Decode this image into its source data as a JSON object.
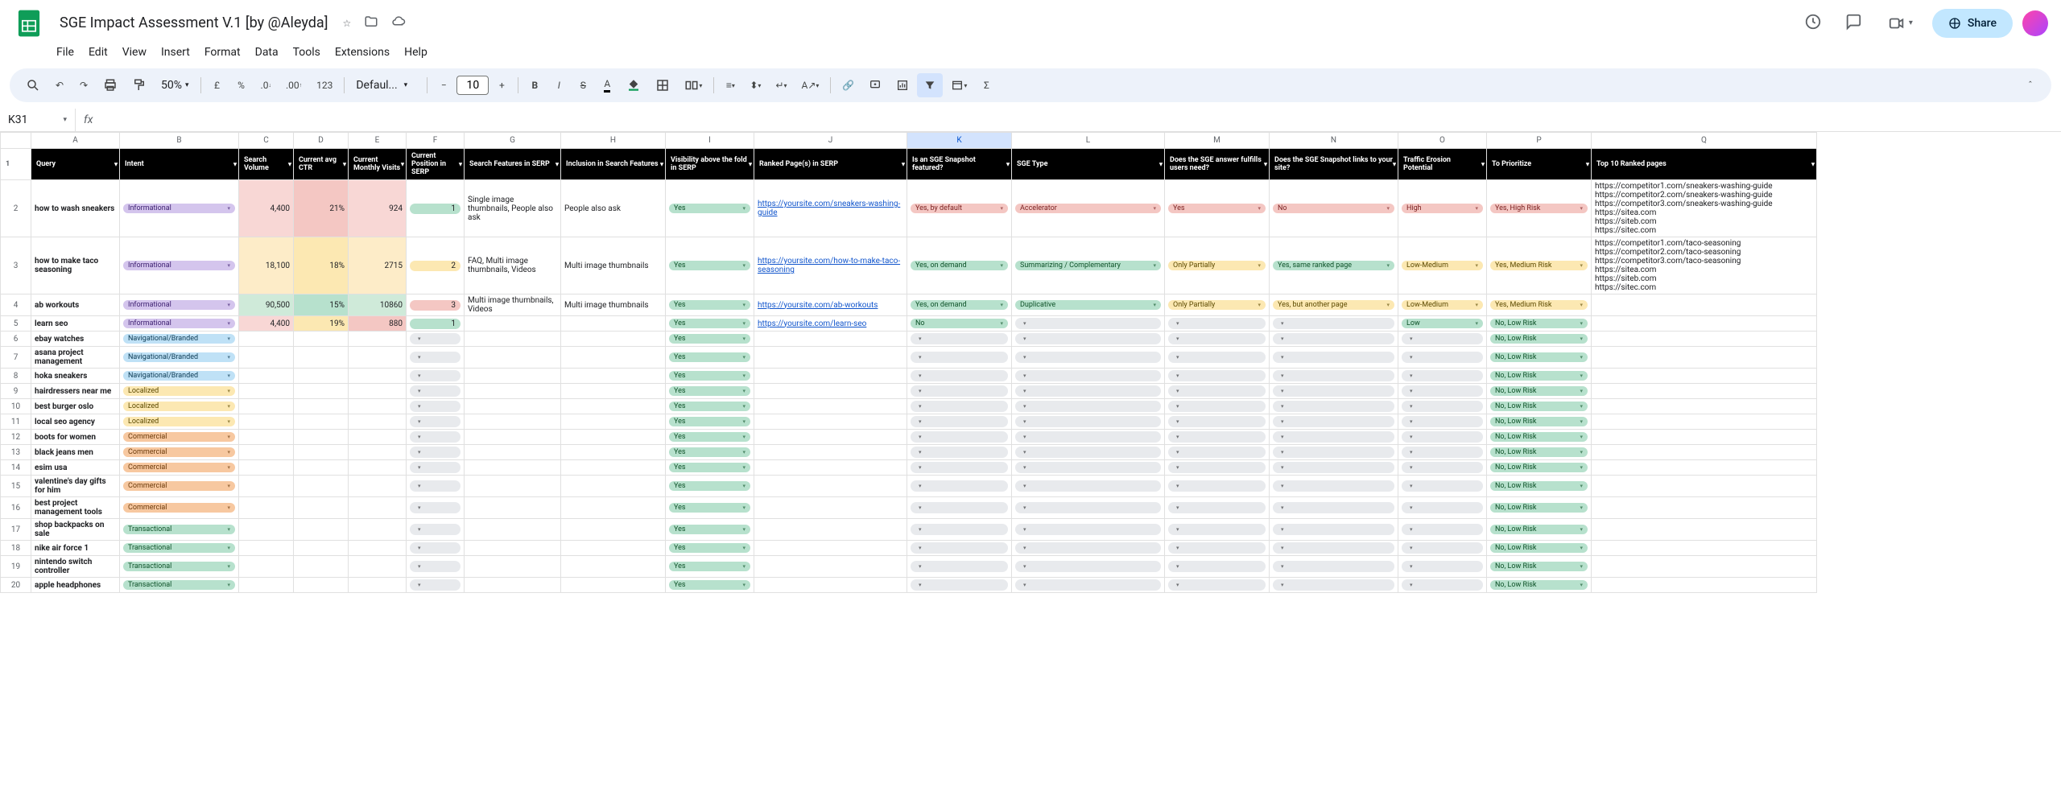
{
  "doc": {
    "title": "SGE Impact Assessment V.1 [by @Aleyda]"
  },
  "menus": [
    "File",
    "Edit",
    "View",
    "Insert",
    "Format",
    "Data",
    "Tools",
    "Extensions",
    "Help"
  ],
  "toolbar": {
    "zoom": "50%",
    "font": "Defaul...",
    "font_size": "10"
  },
  "name_box": "K31",
  "share_label": "Share",
  "column_letters": [
    "A",
    "B",
    "C",
    "D",
    "E",
    "F",
    "G",
    "H",
    "I",
    "J",
    "K",
    "L",
    "M",
    "N",
    "O",
    "P",
    "Q"
  ],
  "headers": [
    "Query",
    "Intent",
    "Search Volume",
    "Current avg CTR",
    "Current Monthly Visits",
    "Current Position in SERP",
    "Search Features in SERP",
    "Inclusion in Search Features",
    "Visibility above the fold in SERP",
    "Ranked Page(s) in SERP",
    "Is an SGE Snapshot featured?",
    "SGE Type",
    "Does the SGE answer fulfills users need?",
    "Does the SGE Snapshot links to your site?",
    "Traffic Erosion Potential",
    "To Prioritize",
    "Top 10 Ranked pages"
  ],
  "chart_data": {
    "type": "table",
    "columns": [
      "Query",
      "Intent",
      "Search Volume",
      "Current avg CTR",
      "Current Monthly Visits",
      "Current Position in SERP",
      "Search Features in SERP",
      "Inclusion in Search Features",
      "Visibility above the fold in SERP",
      "Ranked Page(s) in SERP",
      "Is an SGE Snapshot featured?",
      "SGE Type",
      "Does the SGE answer fulfills users need?",
      "Does the SGE Snapshot links to your site?",
      "Traffic Erosion Potential",
      "To Prioritize",
      "Top 10 Ranked pages"
    ],
    "rows": [
      {
        "row": 2,
        "query": "how to wash sneakers",
        "intent": "Informational",
        "intent_cls": "chip-info",
        "volume": "4,400",
        "vol_cls": "heat-lred",
        "ctr": "21%",
        "ctr_cls": "heat-red",
        "visits": "924",
        "visits_cls": "heat-lred",
        "pos": "1",
        "pos_cls": "pos1",
        "features": "Single image thumbnails, People also ask",
        "inclusion": "People also ask",
        "fold": "Yes",
        "fold_cls": "chip-yes-green",
        "ranked": "https://yoursite.com/sneakers-washing-guide",
        "sge_feat": "Yes, by default",
        "sge_feat_cls": "chip-yes-red",
        "sge_type": "Accelerator",
        "sge_type_cls": "chip-accel",
        "fulfills": "Yes",
        "fulfills_cls": "chip-yes-red",
        "links": "No",
        "links_cls": "chip-no-red",
        "erosion": "High",
        "erosion_cls": "chip-high",
        "prioritize": "Yes, High Risk",
        "pri_cls": "chip-hrisk",
        "top10": "https://competitor1.com/sneakers-washing-guide\nhttps://competitor2.com/sneakers-washing-guide\nhttps://competitor3.com/sneakers-washing-guide\nhttps://sitea.com\nhttps://siteb.com\nhttps://sitec.com"
      },
      {
        "row": 3,
        "query": "how to make taco seasoning",
        "intent": "Informational",
        "intent_cls": "chip-info",
        "volume": "18,100",
        "vol_cls": "heat-lorange",
        "ctr": "18%",
        "ctr_cls": "heat-orange",
        "visits": "2715",
        "visits_cls": "heat-lorange",
        "pos": "2",
        "pos_cls": "pos2",
        "features": "FAQ, Multi image thumbnails, Videos",
        "inclusion": "Multi image thumbnails",
        "fold": "Yes",
        "fold_cls": "chip-yes-green",
        "ranked": "https://yoursite.com/how-to-make-taco-seasoning",
        "sge_feat": "Yes, on demand",
        "sge_feat_cls": "chip-yes-green",
        "sge_type": "Summarizing / Complementary",
        "sge_type_cls": "chip-summ",
        "fulfills": "Only Partially",
        "fulfills_cls": "chip-partial",
        "links": "Yes, same ranked page",
        "links_cls": "chip-yes-same",
        "erosion": "Low-Medium",
        "erosion_cls": "chip-lowmed",
        "prioritize": "Yes, Medium Risk",
        "pri_cls": "chip-mrisk",
        "top10": "https://competitor1.com/taco-seasoning\nhttps://competitor2.com/taco-seasoning\nhttps://competitor3.com/taco-seasoning\nhttps://sitea.com\nhttps://siteb.com\nhttps://sitec.com"
      },
      {
        "row": 4,
        "query": "ab workouts",
        "intent": "Informational",
        "intent_cls": "chip-info",
        "volume": "90,500",
        "vol_cls": "heat-lgreen",
        "ctr": "15%",
        "ctr_cls": "heat-green",
        "visits": "10860",
        "visits_cls": "heat-lgreen",
        "pos": "3",
        "pos_cls": "pos3",
        "features": "Multi image thumbnails, Videos",
        "inclusion": "Multi image thumbnails",
        "fold": "Yes",
        "fold_cls": "chip-yes-green",
        "ranked": "https://yoursite.com/ab-workouts",
        "sge_feat": "Yes, on demand",
        "sge_feat_cls": "chip-yes-green",
        "sge_type": "Duplicative",
        "sge_type_cls": "chip-dup",
        "fulfills": "Only Partially",
        "fulfills_cls": "chip-partial",
        "links": "Yes, but another page",
        "links_cls": "chip-yes-other",
        "erosion": "Low-Medium",
        "erosion_cls": "chip-lowmed",
        "prioritize": "Yes, Medium Risk",
        "pri_cls": "chip-mrisk",
        "top10": ""
      },
      {
        "row": 5,
        "query": "learn seo",
        "intent": "Informational",
        "intent_cls": "chip-info",
        "volume": "4,400",
        "vol_cls": "heat-lred",
        "ctr": "19%",
        "ctr_cls": "heat-orange",
        "visits": "880",
        "visits_cls": "heat-red",
        "pos": "1",
        "pos_cls": "pos1",
        "features": "",
        "inclusion": "",
        "fold": "Yes",
        "fold_cls": "chip-yes-green",
        "ranked": "https://yoursite.com/learn-seo",
        "sge_feat": "No",
        "sge_feat_cls": "chip-no-green",
        "sge_type": "",
        "sge_type_cls": "chip-empty",
        "fulfills": "",
        "fulfills_cls": "chip-empty",
        "links": "",
        "links_cls": "chip-empty",
        "erosion": "Low",
        "erosion_cls": "chip-low",
        "prioritize": "No, Low Risk",
        "pri_cls": "chip-lrisk",
        "top10": ""
      },
      {
        "row": 6,
        "query": "ebay watches",
        "intent": "Navigational/Branded",
        "intent_cls": "chip-nav",
        "volume": "",
        "vol_cls": "",
        "ctr": "",
        "ctr_cls": "",
        "visits": "",
        "visits_cls": "",
        "pos": "",
        "pos_cls": "",
        "features": "",
        "inclusion": "",
        "fold": "Yes",
        "fold_cls": "chip-yes-green",
        "ranked": "",
        "sge_feat": "",
        "sge_feat_cls": "chip-empty",
        "sge_type": "",
        "sge_type_cls": "chip-empty",
        "fulfills": "",
        "fulfills_cls": "chip-empty",
        "links": "",
        "links_cls": "chip-empty",
        "erosion": "",
        "erosion_cls": "chip-empty",
        "prioritize": "No, Low Risk",
        "pri_cls": "chip-lrisk",
        "top10": ""
      },
      {
        "row": 7,
        "query": "asana project management",
        "intent": "Navigational/Branded",
        "intent_cls": "chip-nav",
        "volume": "",
        "vol_cls": "",
        "ctr": "",
        "ctr_cls": "",
        "visits": "",
        "visits_cls": "",
        "pos": "",
        "pos_cls": "",
        "features": "",
        "inclusion": "",
        "fold": "Yes",
        "fold_cls": "chip-yes-green",
        "ranked": "",
        "sge_feat": "",
        "sge_feat_cls": "chip-empty",
        "sge_type": "",
        "sge_type_cls": "chip-empty",
        "fulfills": "",
        "fulfills_cls": "chip-empty",
        "links": "",
        "links_cls": "chip-empty",
        "erosion": "",
        "erosion_cls": "chip-empty",
        "prioritize": "No, Low Risk",
        "pri_cls": "chip-lrisk",
        "top10": ""
      },
      {
        "row": 8,
        "query": "hoka sneakers",
        "intent": "Navigational/Branded",
        "intent_cls": "chip-nav",
        "volume": "",
        "vol_cls": "",
        "ctr": "",
        "ctr_cls": "",
        "visits": "",
        "visits_cls": "",
        "pos": "",
        "pos_cls": "",
        "features": "",
        "inclusion": "",
        "fold": "Yes",
        "fold_cls": "chip-yes-green",
        "ranked": "",
        "sge_feat": "",
        "sge_feat_cls": "chip-empty",
        "sge_type": "",
        "sge_type_cls": "chip-empty",
        "fulfills": "",
        "fulfills_cls": "chip-empty",
        "links": "",
        "links_cls": "chip-empty",
        "erosion": "",
        "erosion_cls": "chip-empty",
        "prioritize": "No, Low Risk",
        "pri_cls": "chip-lrisk",
        "top10": ""
      },
      {
        "row": 9,
        "query": "hairdressers near me",
        "intent": "Localized",
        "intent_cls": "chip-local",
        "volume": "",
        "vol_cls": "",
        "ctr": "",
        "ctr_cls": "",
        "visits": "",
        "visits_cls": "",
        "pos": "",
        "pos_cls": "",
        "features": "",
        "inclusion": "",
        "fold": "Yes",
        "fold_cls": "chip-yes-green",
        "ranked": "",
        "sge_feat": "",
        "sge_feat_cls": "chip-empty",
        "sge_type": "",
        "sge_type_cls": "chip-empty",
        "fulfills": "",
        "fulfills_cls": "chip-empty",
        "links": "",
        "links_cls": "chip-empty",
        "erosion": "",
        "erosion_cls": "chip-empty",
        "prioritize": "No, Low Risk",
        "pri_cls": "chip-lrisk",
        "top10": ""
      },
      {
        "row": 10,
        "query": "best burger oslo",
        "intent": "Localized",
        "intent_cls": "chip-local",
        "volume": "",
        "vol_cls": "",
        "ctr": "",
        "ctr_cls": "",
        "visits": "",
        "visits_cls": "",
        "pos": "",
        "pos_cls": "",
        "features": "",
        "inclusion": "",
        "fold": "Yes",
        "fold_cls": "chip-yes-green",
        "ranked": "",
        "sge_feat": "",
        "sge_feat_cls": "chip-empty",
        "sge_type": "",
        "sge_type_cls": "chip-empty",
        "fulfills": "",
        "fulfills_cls": "chip-empty",
        "links": "",
        "links_cls": "chip-empty",
        "erosion": "",
        "erosion_cls": "chip-empty",
        "prioritize": "No, Low Risk",
        "pri_cls": "chip-lrisk",
        "top10": ""
      },
      {
        "row": 11,
        "query": "local seo agency",
        "intent": "Localized",
        "intent_cls": "chip-local",
        "volume": "",
        "vol_cls": "",
        "ctr": "",
        "ctr_cls": "",
        "visits": "",
        "visits_cls": "",
        "pos": "",
        "pos_cls": "",
        "features": "",
        "inclusion": "",
        "fold": "Yes",
        "fold_cls": "chip-yes-green",
        "ranked": "",
        "sge_feat": "",
        "sge_feat_cls": "chip-empty",
        "sge_type": "",
        "sge_type_cls": "chip-empty",
        "fulfills": "",
        "fulfills_cls": "chip-empty",
        "links": "",
        "links_cls": "chip-empty",
        "erosion": "",
        "erosion_cls": "chip-empty",
        "prioritize": "No, Low Risk",
        "pri_cls": "chip-lrisk",
        "top10": ""
      },
      {
        "row": 12,
        "query": "boots for women",
        "intent": "Commercial",
        "intent_cls": "chip-comm",
        "volume": "",
        "vol_cls": "",
        "ctr": "",
        "ctr_cls": "",
        "visits": "",
        "visits_cls": "",
        "pos": "",
        "pos_cls": "",
        "features": "",
        "inclusion": "",
        "fold": "Yes",
        "fold_cls": "chip-yes-green",
        "ranked": "",
        "sge_feat": "",
        "sge_feat_cls": "chip-empty",
        "sge_type": "",
        "sge_type_cls": "chip-empty",
        "fulfills": "",
        "fulfills_cls": "chip-empty",
        "links": "",
        "links_cls": "chip-empty",
        "erosion": "",
        "erosion_cls": "chip-empty",
        "prioritize": "No, Low Risk",
        "pri_cls": "chip-lrisk",
        "top10": ""
      },
      {
        "row": 13,
        "query": "black jeans men",
        "intent": "Commercial",
        "intent_cls": "chip-comm",
        "volume": "",
        "vol_cls": "",
        "ctr": "",
        "ctr_cls": "",
        "visits": "",
        "visits_cls": "",
        "pos": "",
        "pos_cls": "",
        "features": "",
        "inclusion": "",
        "fold": "Yes",
        "fold_cls": "chip-yes-green",
        "ranked": "",
        "sge_feat": "",
        "sge_feat_cls": "chip-empty",
        "sge_type": "",
        "sge_type_cls": "chip-empty",
        "fulfills": "",
        "fulfills_cls": "chip-empty",
        "links": "",
        "links_cls": "chip-empty",
        "erosion": "",
        "erosion_cls": "chip-empty",
        "prioritize": "No, Low Risk",
        "pri_cls": "chip-lrisk",
        "top10": ""
      },
      {
        "row": 14,
        "query": "esim usa",
        "intent": "Commercial",
        "intent_cls": "chip-comm",
        "volume": "",
        "vol_cls": "",
        "ctr": "",
        "ctr_cls": "",
        "visits": "",
        "visits_cls": "",
        "pos": "",
        "pos_cls": "",
        "features": "",
        "inclusion": "",
        "fold": "Yes",
        "fold_cls": "chip-yes-green",
        "ranked": "",
        "sge_feat": "",
        "sge_feat_cls": "chip-empty",
        "sge_type": "",
        "sge_type_cls": "chip-empty",
        "fulfills": "",
        "fulfills_cls": "chip-empty",
        "links": "",
        "links_cls": "chip-empty",
        "erosion": "",
        "erosion_cls": "chip-empty",
        "prioritize": "No, Low Risk",
        "pri_cls": "chip-lrisk",
        "top10": ""
      },
      {
        "row": 15,
        "query": "valentine's day gifts for him",
        "intent": "Commercial",
        "intent_cls": "chip-comm",
        "volume": "",
        "vol_cls": "",
        "ctr": "",
        "ctr_cls": "",
        "visits": "",
        "visits_cls": "",
        "pos": "",
        "pos_cls": "",
        "features": "",
        "inclusion": "",
        "fold": "Yes",
        "fold_cls": "chip-yes-green",
        "ranked": "",
        "sge_feat": "",
        "sge_feat_cls": "chip-empty",
        "sge_type": "",
        "sge_type_cls": "chip-empty",
        "fulfills": "",
        "fulfills_cls": "chip-empty",
        "links": "",
        "links_cls": "chip-empty",
        "erosion": "",
        "erosion_cls": "chip-empty",
        "prioritize": "No, Low Risk",
        "pri_cls": "chip-lrisk",
        "top10": ""
      },
      {
        "row": 16,
        "query": "best project management tools",
        "intent": "Commercial",
        "intent_cls": "chip-comm",
        "volume": "",
        "vol_cls": "",
        "ctr": "",
        "ctr_cls": "",
        "visits": "",
        "visits_cls": "",
        "pos": "",
        "pos_cls": "",
        "features": "",
        "inclusion": "",
        "fold": "Yes",
        "fold_cls": "chip-yes-green",
        "ranked": "",
        "sge_feat": "",
        "sge_feat_cls": "chip-empty",
        "sge_type": "",
        "sge_type_cls": "chip-empty",
        "fulfills": "",
        "fulfills_cls": "chip-empty",
        "links": "",
        "links_cls": "chip-empty",
        "erosion": "",
        "erosion_cls": "chip-empty",
        "prioritize": "No, Low Risk",
        "pri_cls": "chip-lrisk",
        "top10": ""
      },
      {
        "row": 17,
        "query": "shop backpacks on sale",
        "intent": "Transactional",
        "intent_cls": "chip-trans",
        "volume": "",
        "vol_cls": "",
        "ctr": "",
        "ctr_cls": "",
        "visits": "",
        "visits_cls": "",
        "pos": "",
        "pos_cls": "",
        "features": "",
        "inclusion": "",
        "fold": "Yes",
        "fold_cls": "chip-yes-green",
        "ranked": "",
        "sge_feat": "",
        "sge_feat_cls": "chip-empty",
        "sge_type": "",
        "sge_type_cls": "chip-empty",
        "fulfills": "",
        "fulfills_cls": "chip-empty",
        "links": "",
        "links_cls": "chip-empty",
        "erosion": "",
        "erosion_cls": "chip-empty",
        "prioritize": "No, Low Risk",
        "pri_cls": "chip-lrisk",
        "top10": ""
      },
      {
        "row": 18,
        "query": "nike air force 1",
        "intent": "Transactional",
        "intent_cls": "chip-trans",
        "volume": "",
        "vol_cls": "",
        "ctr": "",
        "ctr_cls": "",
        "visits": "",
        "visits_cls": "",
        "pos": "",
        "pos_cls": "",
        "features": "",
        "inclusion": "",
        "fold": "Yes",
        "fold_cls": "chip-yes-green",
        "ranked": "",
        "sge_feat": "",
        "sge_feat_cls": "chip-empty",
        "sge_type": "",
        "sge_type_cls": "chip-empty",
        "fulfills": "",
        "fulfills_cls": "chip-empty",
        "links": "",
        "links_cls": "chip-empty",
        "erosion": "",
        "erosion_cls": "chip-empty",
        "prioritize": "No, Low Risk",
        "pri_cls": "chip-lrisk",
        "top10": ""
      },
      {
        "row": 19,
        "query": "nintendo switch controller",
        "intent": "Transactional",
        "intent_cls": "chip-trans",
        "volume": "",
        "vol_cls": "",
        "ctr": "",
        "ctr_cls": "",
        "visits": "",
        "visits_cls": "",
        "pos": "",
        "pos_cls": "",
        "features": "",
        "inclusion": "",
        "fold": "Yes",
        "fold_cls": "chip-yes-green",
        "ranked": "",
        "sge_feat": "",
        "sge_feat_cls": "chip-empty",
        "sge_type": "",
        "sge_type_cls": "chip-empty",
        "fulfills": "",
        "fulfills_cls": "chip-empty",
        "links": "",
        "links_cls": "chip-empty",
        "erosion": "",
        "erosion_cls": "chip-empty",
        "prioritize": "No, Low Risk",
        "pri_cls": "chip-lrisk",
        "top10": ""
      },
      {
        "row": 20,
        "query": "apple headphones",
        "intent": "Transactional",
        "intent_cls": "chip-trans",
        "volume": "",
        "vol_cls": "",
        "ctr": "",
        "ctr_cls": "",
        "visits": "",
        "visits_cls": "",
        "pos": "",
        "pos_cls": "",
        "features": "",
        "inclusion": "",
        "fold": "Yes",
        "fold_cls": "chip-yes-green",
        "ranked": "",
        "sge_feat": "",
        "sge_feat_cls": "chip-empty",
        "sge_type": "",
        "sge_type_cls": "chip-empty",
        "fulfills": "",
        "fulfills_cls": "chip-empty",
        "links": "",
        "links_cls": "chip-empty",
        "erosion": "",
        "erosion_cls": "chip-empty",
        "prioritize": "No, Low Risk",
        "pri_cls": "chip-lrisk",
        "top10": ""
      }
    ]
  }
}
